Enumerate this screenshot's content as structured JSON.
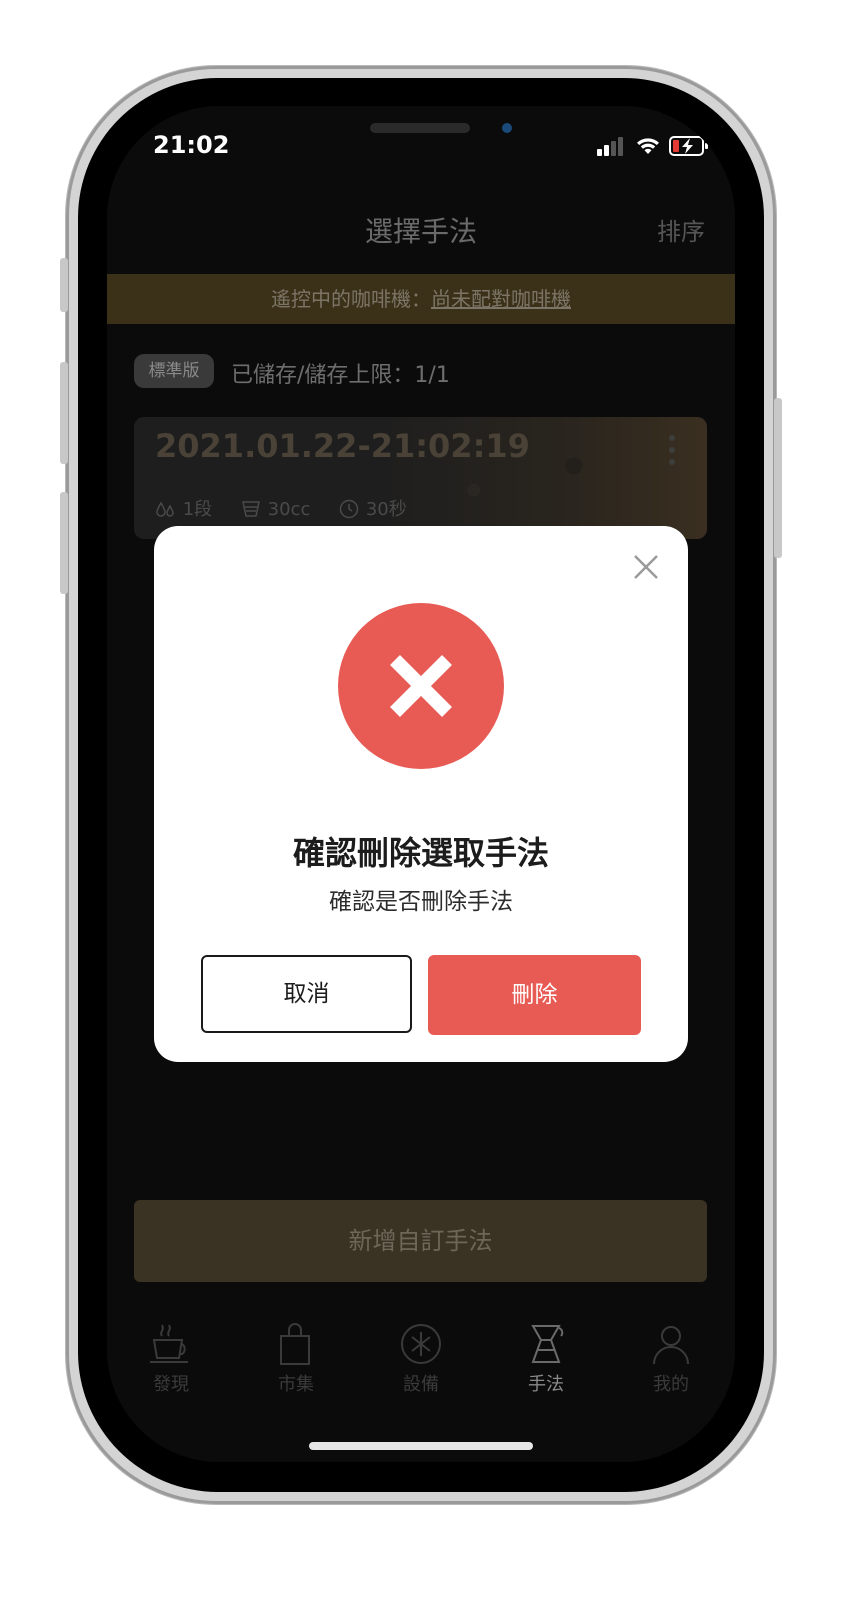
{
  "status_bar": {
    "time": "21:02"
  },
  "header": {
    "title": "選擇手法",
    "sort_label": "排序"
  },
  "banner": {
    "prefix": "遙控中的咖啡機：",
    "link": "尚未配對咖啡機"
  },
  "plan": {
    "badge": "標準版",
    "text": "已儲存/儲存上限：1/1"
  },
  "recipe": {
    "title": "2021.01.22-21:02:19",
    "stages": "1段",
    "volume": "30cc",
    "time": "30秒"
  },
  "add_button": "新增自訂手法",
  "tabs": [
    {
      "label": "發現",
      "icon": "coffee-cup-icon"
    },
    {
      "label": "市集",
      "icon": "shopping-bag-icon"
    },
    {
      "label": "設備",
      "icon": "device-icon"
    },
    {
      "label": "手法",
      "icon": "dripper-icon",
      "active": true
    },
    {
      "label": "我的",
      "icon": "profile-icon"
    }
  ],
  "modal": {
    "title": "確認刪除選取手法",
    "subtitle": "確認是否刪除手法",
    "cancel_label": "取消",
    "delete_label": "刪除"
  },
  "colors": {
    "accent_red": "#e85b55",
    "banner_bg": "#3b3118",
    "screen_bg": "#0b0b0b"
  }
}
